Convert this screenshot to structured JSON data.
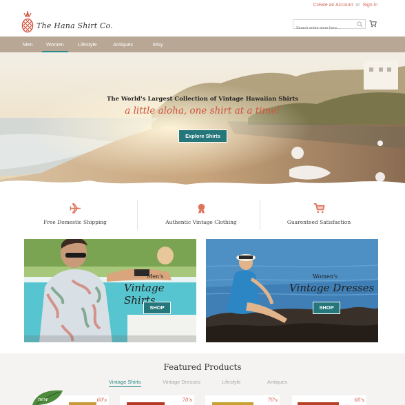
{
  "header": {
    "create_account": "Create an Account",
    "or": "or",
    "sign_in": "Sign in",
    "logo_text": "The Hana Shirt Co.",
    "search_placeholder": "Search entire store here...",
    "icons": {
      "logo": "pineapple-icon",
      "search": "search-icon",
      "cart": "cart-icon"
    }
  },
  "nav": {
    "items": [
      {
        "label": "Men",
        "active": false
      },
      {
        "label": "Women",
        "active": true
      },
      {
        "label": "Lifestyle",
        "active": false
      },
      {
        "label": "Antiques",
        "active": false
      },
      {
        "label": "Etsy",
        "active": false
      }
    ]
  },
  "hero": {
    "title": "The World's Largest Collection of Vintage Hawaiian Shirts",
    "tagline": "a little aloha, one shirt at a time!",
    "button": "Explore Shirts"
  },
  "features": [
    {
      "label": "Free Domestic Shipping",
      "icon": "airplane-icon"
    },
    {
      "label": "Authentic Vintage Clothing",
      "icon": "ribbon-icon"
    },
    {
      "label": "Guarenteed Satisfaction",
      "icon": "cart-icon"
    }
  ],
  "promos": [
    {
      "pre": "Men's",
      "title": "Vintage Shirts",
      "button": "SHOP"
    },
    {
      "pre": "Women's",
      "title": "Vintage Dresses",
      "button": "SHOP"
    }
  ],
  "featured": {
    "title": "Featured Products",
    "tabs": [
      {
        "label": "Vintage Shirts",
        "active": true
      },
      {
        "label": "Vintage Dresses",
        "active": false
      },
      {
        "label": "Lifestyle",
        "active": false
      },
      {
        "label": "Antiques",
        "active": false
      }
    ],
    "new_badge": "new",
    "products": [
      {
        "era": "60's"
      },
      {
        "era": "70's"
      },
      {
        "era": "70's"
      },
      {
        "era": "60's"
      }
    ]
  },
  "colors": {
    "nav_bg": "#b8a795",
    "accent_teal": "#25777b",
    "accent_coral": "#d0523c"
  }
}
